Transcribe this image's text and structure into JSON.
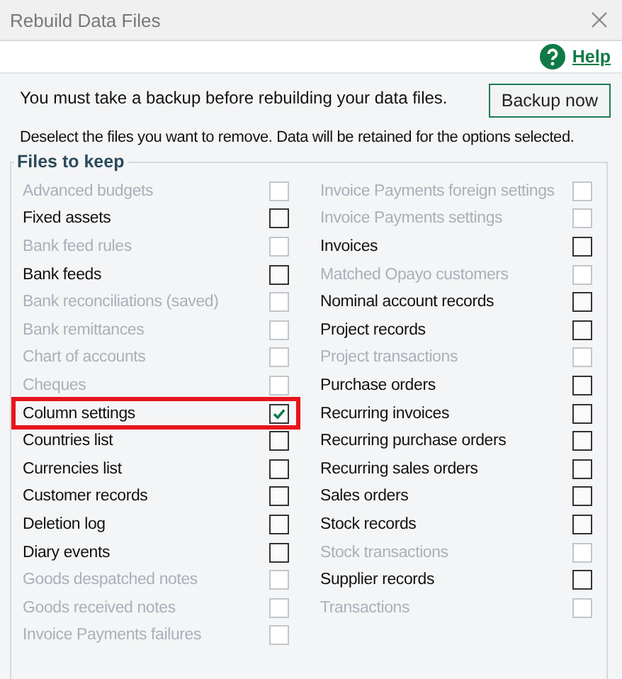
{
  "window": {
    "title": "Rebuild Data Files"
  },
  "help": {
    "label": "Help"
  },
  "backup_message": "You must take a backup before rebuilding your data files.",
  "backup_button": "Backup now",
  "instructions": "Deselect the files you want to remove. Data will be retained for the options selected.",
  "group": {
    "title": "Files to keep",
    "columns": [
      [
        {
          "label": "Advanced budgets",
          "disabled": true,
          "checked": false,
          "highlighted": false
        },
        {
          "label": "Fixed assets",
          "disabled": false,
          "checked": false,
          "highlighted": false
        },
        {
          "label": "Bank feed rules",
          "disabled": true,
          "checked": false,
          "highlighted": false
        },
        {
          "label": "Bank feeds",
          "disabled": false,
          "checked": false,
          "highlighted": false
        },
        {
          "label": "Bank reconciliations (saved)",
          "disabled": true,
          "checked": false,
          "highlighted": false
        },
        {
          "label": "Bank remittances",
          "disabled": true,
          "checked": false,
          "highlighted": false
        },
        {
          "label": "Chart of accounts",
          "disabled": true,
          "checked": false,
          "highlighted": false
        },
        {
          "label": "Cheques",
          "disabled": true,
          "checked": false,
          "highlighted": false
        },
        {
          "label": "Column settings",
          "disabled": false,
          "checked": true,
          "highlighted": true
        },
        {
          "label": "Countries list",
          "disabled": false,
          "checked": false,
          "highlighted": false
        },
        {
          "label": "Currencies list",
          "disabled": false,
          "checked": false,
          "highlighted": false
        },
        {
          "label": "Customer records",
          "disabled": false,
          "checked": false,
          "highlighted": false
        },
        {
          "label": "Deletion log",
          "disabled": false,
          "checked": false,
          "highlighted": false
        },
        {
          "label": "Diary events",
          "disabled": false,
          "checked": false,
          "highlighted": false
        },
        {
          "label": "Goods despatched notes",
          "disabled": true,
          "checked": false,
          "highlighted": false
        },
        {
          "label": "Goods received notes",
          "disabled": true,
          "checked": false,
          "highlighted": false
        },
        {
          "label": "Invoice Payments failures",
          "disabled": true,
          "checked": false,
          "highlighted": false
        }
      ],
      [
        {
          "label": "Invoice Payments foreign settings",
          "disabled": true,
          "checked": false,
          "highlighted": false
        },
        {
          "label": "Invoice Payments settings",
          "disabled": true,
          "checked": false,
          "highlighted": false
        },
        {
          "label": "Invoices",
          "disabled": false,
          "checked": false,
          "highlighted": false
        },
        {
          "label": "Matched Opayo customers",
          "disabled": true,
          "checked": false,
          "highlighted": false
        },
        {
          "label": "Nominal account records",
          "disabled": false,
          "checked": false,
          "highlighted": false
        },
        {
          "label": "Project records",
          "disabled": false,
          "checked": false,
          "highlighted": false
        },
        {
          "label": "Project transactions",
          "disabled": true,
          "checked": false,
          "highlighted": false
        },
        {
          "label": "Purchase orders",
          "disabled": false,
          "checked": false,
          "highlighted": false
        },
        {
          "label": "Recurring invoices",
          "disabled": false,
          "checked": false,
          "highlighted": false
        },
        {
          "label": "Recurring purchase orders",
          "disabled": false,
          "checked": false,
          "highlighted": false
        },
        {
          "label": "Recurring sales orders",
          "disabled": false,
          "checked": false,
          "highlighted": false
        },
        {
          "label": "Sales orders",
          "disabled": false,
          "checked": false,
          "highlighted": false
        },
        {
          "label": "Stock records",
          "disabled": false,
          "checked": false,
          "highlighted": false
        },
        {
          "label": "Stock transactions",
          "disabled": true,
          "checked": false,
          "highlighted": false
        },
        {
          "label": "Supplier records",
          "disabled": false,
          "checked": false,
          "highlighted": false
        },
        {
          "label": "Transactions",
          "disabled": true,
          "checked": false,
          "highlighted": false
        }
      ]
    ]
  }
}
